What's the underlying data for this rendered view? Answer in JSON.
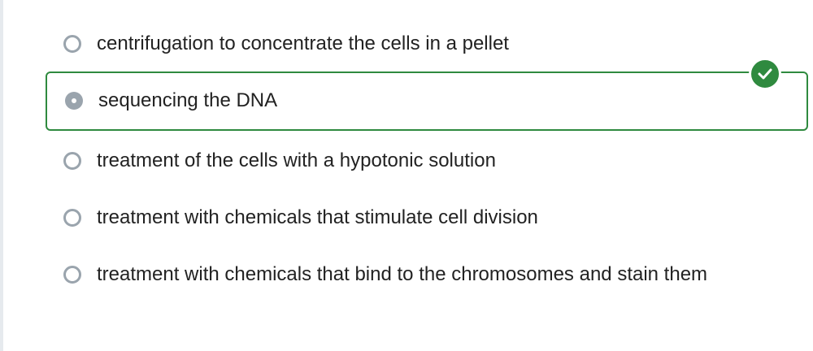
{
  "question": {
    "options": [
      {
        "label": "centrifugation to concentrate the cells in a pellet",
        "selected": false
      },
      {
        "label": "sequencing the DNA",
        "selected": true,
        "correct": true
      },
      {
        "label": "treatment of the cells with a hypotonic solution",
        "selected": false
      },
      {
        "label": "treatment with chemicals that stimulate cell division",
        "selected": false
      },
      {
        "label": "treatment with chemicals that bind to the chromosomes and stain them",
        "selected": false
      }
    ]
  },
  "colors": {
    "correct_accent": "#2f8a3f",
    "radio": "#9aa4ad",
    "text": "#222222"
  },
  "icons": {
    "correct_badge": "check-icon"
  }
}
